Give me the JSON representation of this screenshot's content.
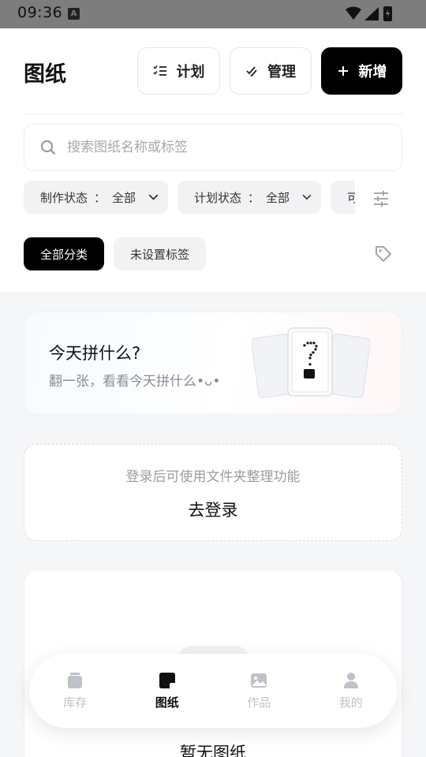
{
  "status_bar": {
    "time": "09:36",
    "a_icon": "A"
  },
  "header": {
    "title": "图纸",
    "plan_label": "计划",
    "manage_label": "管理",
    "add_label": "新增"
  },
  "search": {
    "placeholder": "搜索图纸名称或标签"
  },
  "filters": [
    {
      "label": "制作状态",
      "sep": "：",
      "value": "全部"
    },
    {
      "label": "计划状态",
      "sep": "：",
      "value": "全部"
    },
    {
      "label": "可"
    }
  ],
  "categories": [
    {
      "label": "全部分类",
      "active": true
    },
    {
      "label": "未设置标签",
      "active": false
    }
  ],
  "today_card": {
    "title": "今天拼什么?",
    "subtitle": "翻一张，看看今天拼什么•ᴗ•"
  },
  "login_card": {
    "hint": "登录后可使用文件夹整理功能",
    "action": "去登录"
  },
  "empty_card": {
    "text": "暂无图纸"
  },
  "bottom_nav": [
    {
      "label": "库存",
      "icon": "box-icon",
      "active": false
    },
    {
      "label": "图纸",
      "icon": "note-icon",
      "active": true
    },
    {
      "label": "作品",
      "icon": "image-icon",
      "active": false
    },
    {
      "label": "我的",
      "icon": "person-icon",
      "active": false
    }
  ],
  "colors": {
    "accent": "#000000",
    "chip_bg": "#f1f2f4",
    "muted": "#bfc2c8"
  }
}
